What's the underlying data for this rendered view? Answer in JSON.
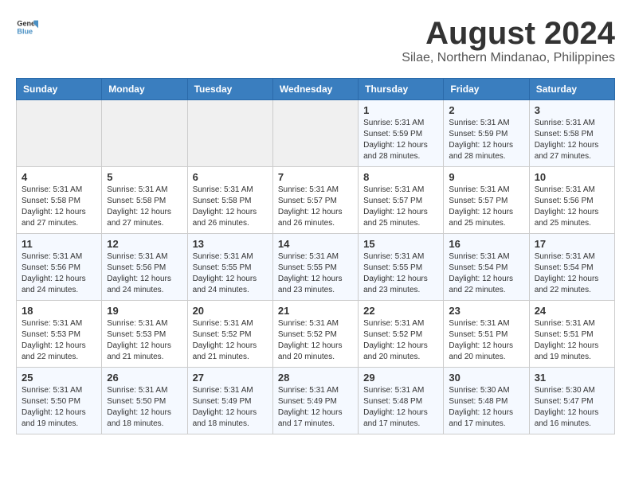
{
  "header": {
    "logo_line1": "General",
    "logo_line2": "Blue",
    "title": "August 2024",
    "subtitle": "Silae, Northern Mindanao, Philippines"
  },
  "weekdays": [
    "Sunday",
    "Monday",
    "Tuesday",
    "Wednesday",
    "Thursday",
    "Friday",
    "Saturday"
  ],
  "weeks": [
    [
      {
        "day": "",
        "info": ""
      },
      {
        "day": "",
        "info": ""
      },
      {
        "day": "",
        "info": ""
      },
      {
        "day": "",
        "info": ""
      },
      {
        "day": "1",
        "info": "Sunrise: 5:31 AM\nSunset: 5:59 PM\nDaylight: 12 hours\nand 28 minutes."
      },
      {
        "day": "2",
        "info": "Sunrise: 5:31 AM\nSunset: 5:59 PM\nDaylight: 12 hours\nand 28 minutes."
      },
      {
        "day": "3",
        "info": "Sunrise: 5:31 AM\nSunset: 5:58 PM\nDaylight: 12 hours\nand 27 minutes."
      }
    ],
    [
      {
        "day": "4",
        "info": "Sunrise: 5:31 AM\nSunset: 5:58 PM\nDaylight: 12 hours\nand 27 minutes."
      },
      {
        "day": "5",
        "info": "Sunrise: 5:31 AM\nSunset: 5:58 PM\nDaylight: 12 hours\nand 27 minutes."
      },
      {
        "day": "6",
        "info": "Sunrise: 5:31 AM\nSunset: 5:58 PM\nDaylight: 12 hours\nand 26 minutes."
      },
      {
        "day": "7",
        "info": "Sunrise: 5:31 AM\nSunset: 5:57 PM\nDaylight: 12 hours\nand 26 minutes."
      },
      {
        "day": "8",
        "info": "Sunrise: 5:31 AM\nSunset: 5:57 PM\nDaylight: 12 hours\nand 25 minutes."
      },
      {
        "day": "9",
        "info": "Sunrise: 5:31 AM\nSunset: 5:57 PM\nDaylight: 12 hours\nand 25 minutes."
      },
      {
        "day": "10",
        "info": "Sunrise: 5:31 AM\nSunset: 5:56 PM\nDaylight: 12 hours\nand 25 minutes."
      }
    ],
    [
      {
        "day": "11",
        "info": "Sunrise: 5:31 AM\nSunset: 5:56 PM\nDaylight: 12 hours\nand 24 minutes."
      },
      {
        "day": "12",
        "info": "Sunrise: 5:31 AM\nSunset: 5:56 PM\nDaylight: 12 hours\nand 24 minutes."
      },
      {
        "day": "13",
        "info": "Sunrise: 5:31 AM\nSunset: 5:55 PM\nDaylight: 12 hours\nand 24 minutes."
      },
      {
        "day": "14",
        "info": "Sunrise: 5:31 AM\nSunset: 5:55 PM\nDaylight: 12 hours\nand 23 minutes."
      },
      {
        "day": "15",
        "info": "Sunrise: 5:31 AM\nSunset: 5:55 PM\nDaylight: 12 hours\nand 23 minutes."
      },
      {
        "day": "16",
        "info": "Sunrise: 5:31 AM\nSunset: 5:54 PM\nDaylight: 12 hours\nand 22 minutes."
      },
      {
        "day": "17",
        "info": "Sunrise: 5:31 AM\nSunset: 5:54 PM\nDaylight: 12 hours\nand 22 minutes."
      }
    ],
    [
      {
        "day": "18",
        "info": "Sunrise: 5:31 AM\nSunset: 5:53 PM\nDaylight: 12 hours\nand 22 minutes."
      },
      {
        "day": "19",
        "info": "Sunrise: 5:31 AM\nSunset: 5:53 PM\nDaylight: 12 hours\nand 21 minutes."
      },
      {
        "day": "20",
        "info": "Sunrise: 5:31 AM\nSunset: 5:52 PM\nDaylight: 12 hours\nand 21 minutes."
      },
      {
        "day": "21",
        "info": "Sunrise: 5:31 AM\nSunset: 5:52 PM\nDaylight: 12 hours\nand 20 minutes."
      },
      {
        "day": "22",
        "info": "Sunrise: 5:31 AM\nSunset: 5:52 PM\nDaylight: 12 hours\nand 20 minutes."
      },
      {
        "day": "23",
        "info": "Sunrise: 5:31 AM\nSunset: 5:51 PM\nDaylight: 12 hours\nand 20 minutes."
      },
      {
        "day": "24",
        "info": "Sunrise: 5:31 AM\nSunset: 5:51 PM\nDaylight: 12 hours\nand 19 minutes."
      }
    ],
    [
      {
        "day": "25",
        "info": "Sunrise: 5:31 AM\nSunset: 5:50 PM\nDaylight: 12 hours\nand 19 minutes."
      },
      {
        "day": "26",
        "info": "Sunrise: 5:31 AM\nSunset: 5:50 PM\nDaylight: 12 hours\nand 18 minutes."
      },
      {
        "day": "27",
        "info": "Sunrise: 5:31 AM\nSunset: 5:49 PM\nDaylight: 12 hours\nand 18 minutes."
      },
      {
        "day": "28",
        "info": "Sunrise: 5:31 AM\nSunset: 5:49 PM\nDaylight: 12 hours\nand 17 minutes."
      },
      {
        "day": "29",
        "info": "Sunrise: 5:31 AM\nSunset: 5:48 PM\nDaylight: 12 hours\nand 17 minutes."
      },
      {
        "day": "30",
        "info": "Sunrise: 5:30 AM\nSunset: 5:48 PM\nDaylight: 12 hours\nand 17 minutes."
      },
      {
        "day": "31",
        "info": "Sunrise: 5:30 AM\nSunset: 5:47 PM\nDaylight: 12 hours\nand 16 minutes."
      }
    ]
  ]
}
